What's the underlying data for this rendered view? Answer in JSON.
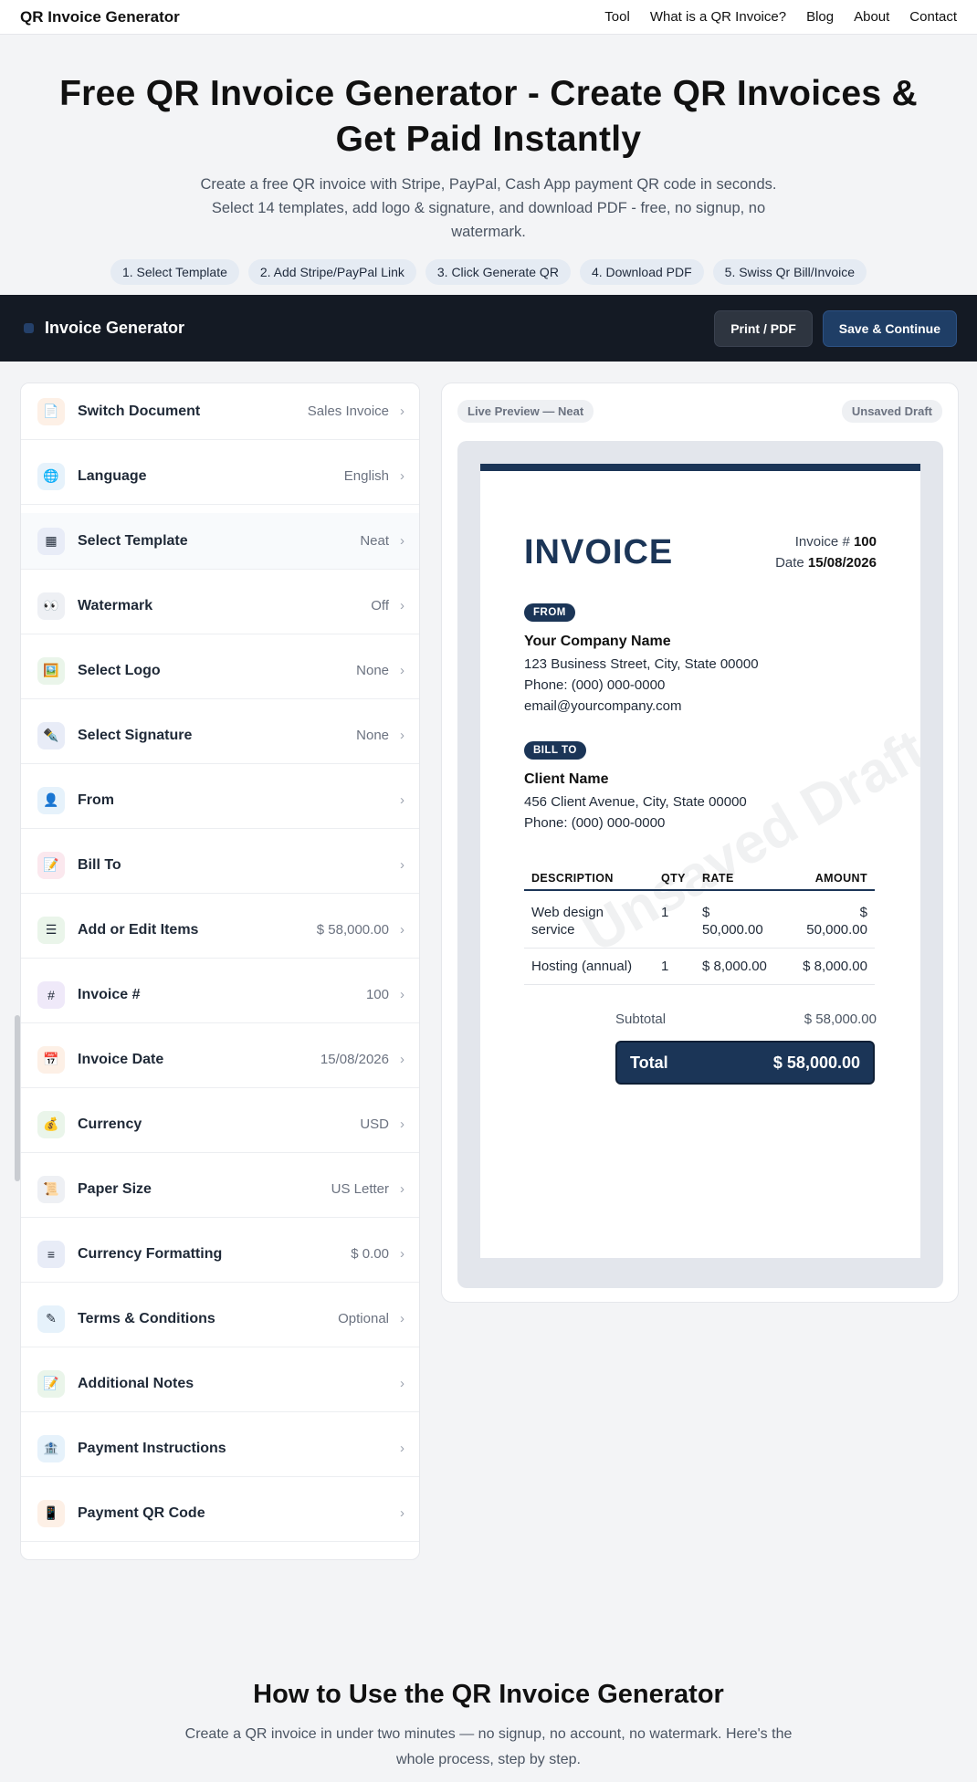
{
  "nav": {
    "brand": "QR Invoice Generator",
    "links": [
      "Tool",
      "What is a QR Invoice?",
      "Blog",
      "About",
      "Contact"
    ]
  },
  "hero": {
    "title": "Free QR Invoice Generator - Create QR Invoices & Get Paid Instantly",
    "subtitle": "Create a free QR invoice with Stripe, PayPal, Cash App payment QR code in seconds. Select 14 templates, add logo & signature, and download PDF - free, no signup, no watermark.",
    "steps": [
      "1. Select Template",
      "2. Add Stripe/PayPal Link",
      "3. Click Generate QR",
      "4. Download PDF",
      "5. Swiss Qr Bill/Invoice"
    ]
  },
  "toolbar": {
    "title": "Invoice Generator",
    "print_label": "Print / PDF",
    "save_label": "Save & Continue"
  },
  "settings": [
    {
      "label": "Switch Document",
      "value": "Sales Invoice",
      "icon": "📄",
      "icon_name": "document-icon",
      "bg": "#fdf0e6"
    },
    {
      "label": "Language",
      "value": "English",
      "icon": "🌐",
      "icon_name": "globe-icon",
      "bg": "#e6f2fb"
    },
    {
      "label": "Select Template",
      "value": "Neat",
      "icon": "▦",
      "icon_name": "template-icon",
      "bg": "#e8ecf7"
    },
    {
      "label": "Watermark",
      "value": "Off",
      "icon": "👀",
      "icon_name": "eyes-icon",
      "bg": "#eef0f4"
    },
    {
      "label": "Select Logo",
      "value": "None",
      "icon": "🖼️",
      "icon_name": "image-icon",
      "bg": "#eaf5ea"
    },
    {
      "label": "Select Signature",
      "value": "None",
      "icon": "✒️",
      "icon_name": "pen-icon",
      "bg": "#e8ecf7"
    },
    {
      "label": "From",
      "value": "",
      "icon": "👤",
      "icon_name": "user-icon",
      "bg": "#e6f2fb"
    },
    {
      "label": "Bill To",
      "value": "",
      "icon": "📝",
      "icon_name": "memo-icon",
      "bg": "#fbe8ee"
    },
    {
      "label": "Add or Edit Items",
      "value": "$ 58,000.00",
      "icon": "☰",
      "icon_name": "list-icon",
      "bg": "#eaf5ea"
    },
    {
      "label": "Invoice #",
      "value": "100",
      "icon": "#",
      "icon_name": "hash-icon",
      "bg": "#efe9f9"
    },
    {
      "label": "Invoice Date",
      "value": "15/08/2026",
      "icon": "📅",
      "icon_name": "calendar-icon",
      "bg": "#fdf0e6"
    },
    {
      "label": "Currency",
      "value": "USD",
      "icon": "💰",
      "icon_name": "money-bag-icon",
      "bg": "#eaf5ea"
    },
    {
      "label": "Paper Size",
      "value": "US Letter",
      "icon": "📜",
      "icon_name": "scroll-icon",
      "bg": "#eef0f4"
    },
    {
      "label": "Currency Formatting",
      "value": "$ 0.00",
      "icon": "≡",
      "icon_name": "format-icon",
      "bg": "#e8ecf7"
    },
    {
      "label": "Terms & Conditions",
      "value": "Optional",
      "icon": "✎",
      "icon_name": "pen-icon",
      "bg": "#e6f2fb"
    },
    {
      "label": "Additional Notes",
      "value": "",
      "icon": "📝",
      "icon_name": "memo-icon",
      "bg": "#eaf5ea"
    },
    {
      "label": "Payment Instructions",
      "value": "",
      "icon": "🏦",
      "icon_name": "bank-icon",
      "bg": "#e6f2fb"
    },
    {
      "label": "Payment QR Code",
      "value": "",
      "icon": "📱",
      "icon_name": "phone-icon",
      "bg": "#fdf0e6"
    }
  ],
  "preview": {
    "live_label": "Live Preview — Neat",
    "status_label": "Unsaved Draft"
  },
  "invoice": {
    "title": "INVOICE",
    "number_label": "Invoice #",
    "number": "100",
    "date_label": "Date",
    "date": "15/08/2026",
    "from_tag": "FROM",
    "from": {
      "name": "Your Company Name",
      "address": "123 Business Street, City, State 00000",
      "phone": "Phone: (000) 000-0000",
      "email": "email@yourcompany.com"
    },
    "billto_tag": "BILL TO",
    "billto": {
      "name": "Client Name",
      "address": "456 Client Avenue, City, State 00000",
      "phone": "Phone: (000) 000-0000"
    },
    "watermark": "Unsaved Draft",
    "columns": [
      "DESCRIPTION",
      "QTY",
      "RATE",
      "AMOUNT"
    ],
    "items": [
      {
        "desc1": "Web design",
        "desc2": "service",
        "qty": "1",
        "rate1": "$",
        "rate2": "50,000.00",
        "amount1": "$",
        "amount2": "50,000.00"
      },
      {
        "desc1": "Hosting (annual)",
        "desc2": "",
        "qty": "1",
        "rate1": "$ 8,000.00",
        "rate2": "",
        "amount1": "$ 8,000.00",
        "amount2": ""
      }
    ],
    "subtotal_label": "Subtotal",
    "subtotal": "$ 58,000.00",
    "total_label": "Total",
    "total": "$ 58,000.00"
  },
  "howto": {
    "title": "How to Use the QR Invoice Generator",
    "subtitle": "Create a QR invoice in under two minutes — no signup, no account, no watermark. Here's the whole process, step by step."
  }
}
